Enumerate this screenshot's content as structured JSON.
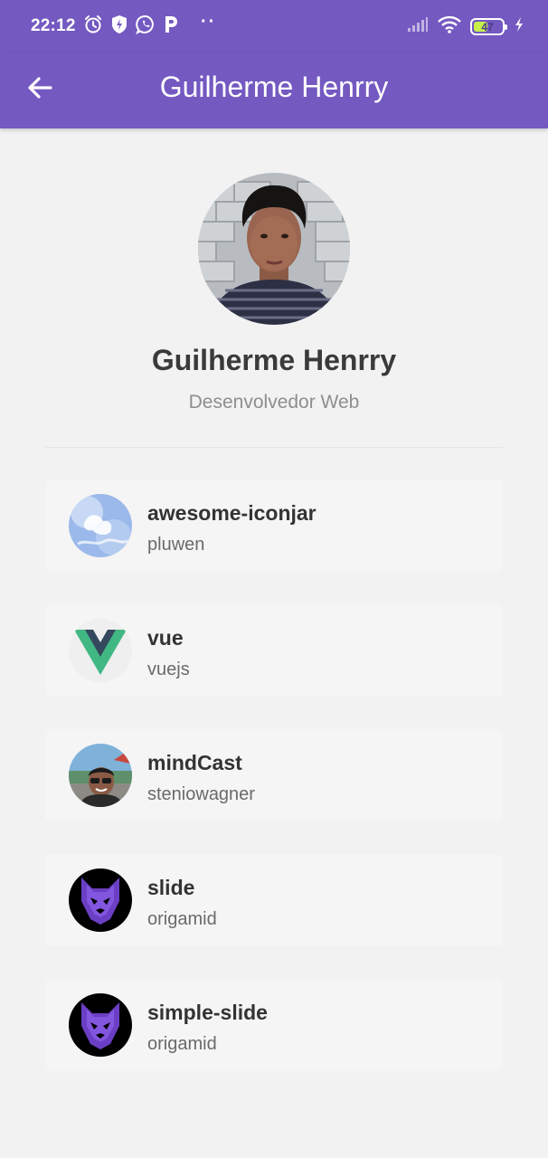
{
  "status_bar": {
    "time": "22:12",
    "dots": "··",
    "battery": "47",
    "icons": [
      "alarm-icon",
      "shield-icon",
      "whatsapp-icon",
      "p-icon",
      "signal-icon",
      "wifi-icon",
      "battery-icon",
      "charging-icon"
    ]
  },
  "app_bar": {
    "title": "Guilherme Henrry",
    "back_icon": "arrow-left-icon",
    "background": "#7459c1"
  },
  "profile": {
    "name": "Guilherme Henrry",
    "bio": "Desenvolvedor Web"
  },
  "repositories": [
    {
      "name": "awesome-iconjar",
      "owner": "pluwen"
    },
    {
      "name": "vue",
      "owner": "vuejs"
    },
    {
      "name": "mindCast",
      "owner": "steniowagner"
    },
    {
      "name": "slide",
      "owner": "origamid"
    },
    {
      "name": "simple-slide",
      "owner": "origamid"
    }
  ]
}
